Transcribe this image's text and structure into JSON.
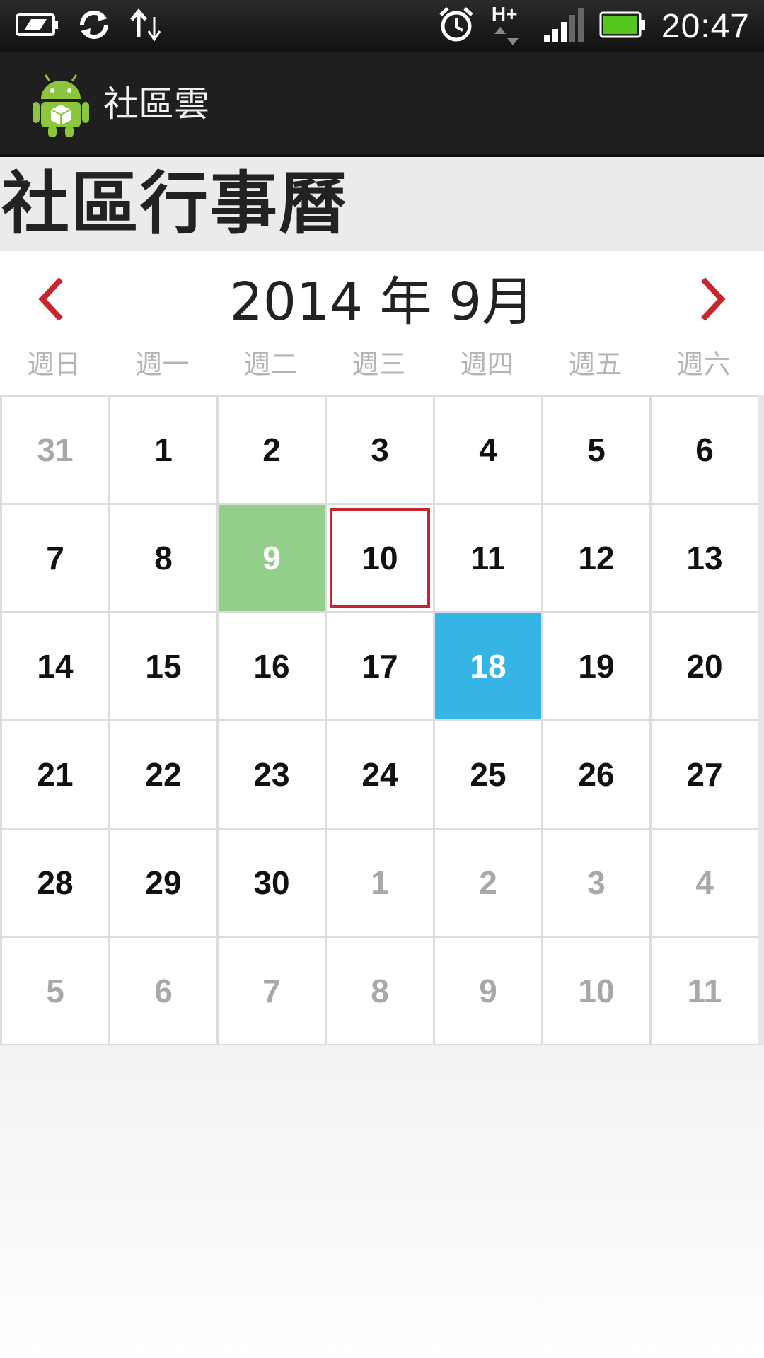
{
  "status_bar": {
    "time": "20:47",
    "network": "H+",
    "icons": [
      "battery-saver-icon",
      "sync-icon",
      "data-transfer-icon",
      "alarm-icon",
      "network-type-icon",
      "signal-icon",
      "battery-icon"
    ]
  },
  "action_bar": {
    "title": "社區雲",
    "icon": "android-app-icon"
  },
  "page": {
    "title": "社區行事曆"
  },
  "calendar": {
    "month_label": "2014 年 9月",
    "prev_icon": "chevron-left-icon",
    "next_icon": "chevron-right-icon",
    "accent_color": "#c8262d",
    "weekdays": [
      "週日",
      "週一",
      "週二",
      "週三",
      "週四",
      "週五",
      "週六"
    ],
    "weeks": [
      [
        "31",
        "1",
        "2",
        "3",
        "4",
        "5",
        "6"
      ],
      [
        "7",
        "8",
        "9",
        "10",
        "11",
        "12",
        "13"
      ],
      [
        "14",
        "15",
        "16",
        "17",
        "18",
        "19",
        "20"
      ],
      [
        "21",
        "22",
        "23",
        "24",
        "25",
        "26",
        "27"
      ],
      [
        "28",
        "29",
        "30",
        "1",
        "2",
        "3",
        "4"
      ],
      [
        "5",
        "6",
        "7",
        "8",
        "9",
        "10",
        "11"
      ]
    ],
    "selected_day": "9",
    "selected_color": "#92cf8a",
    "today": "18",
    "today_color": "#35b4e6",
    "focused_day": "10"
  }
}
